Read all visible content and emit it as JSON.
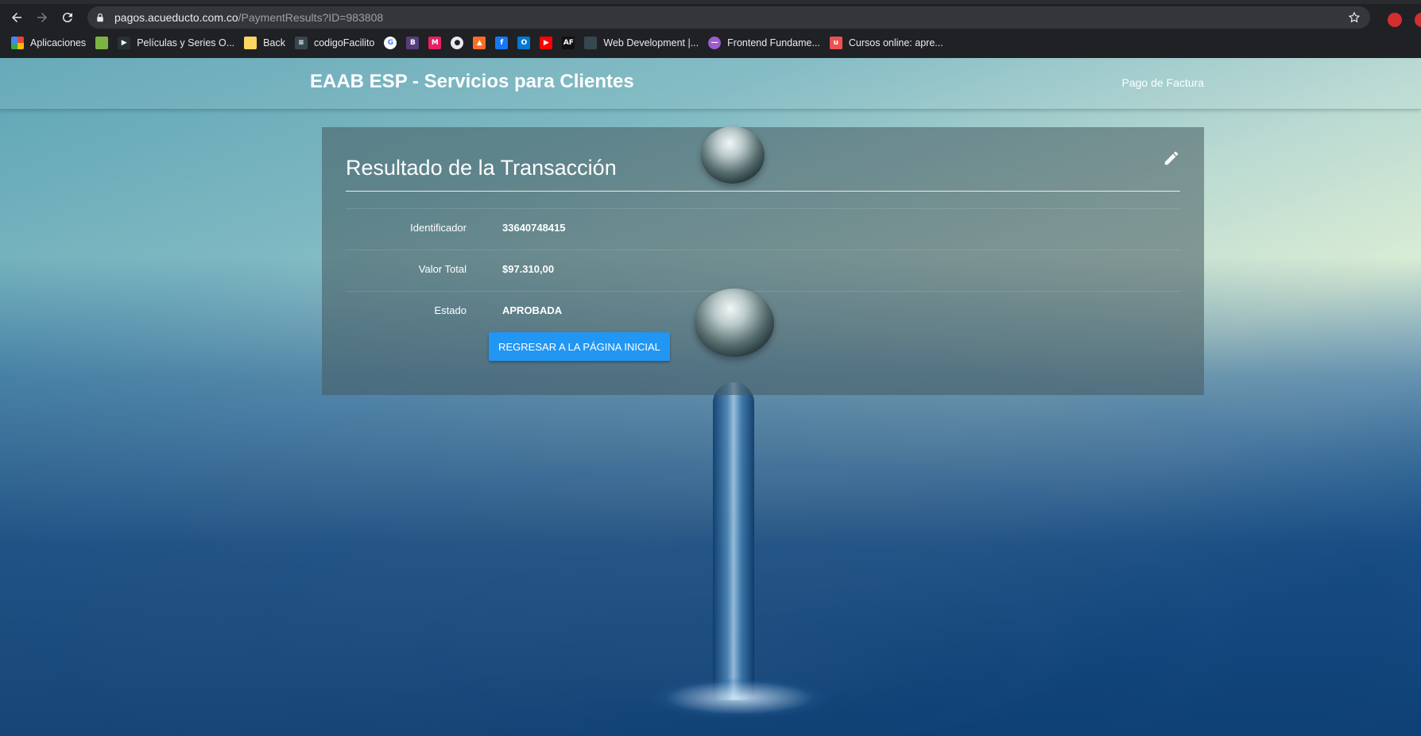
{
  "browser": {
    "url_domain": "pagos.acueducto.com.co",
    "url_path": "/PaymentResults?ID=983808",
    "bookmarks": [
      {
        "label": "Aplicaciones",
        "icon": "apps-grid-icon",
        "color": "#4285f4"
      },
      {
        "label": "",
        "icon": "android-icon",
        "color": "#7cb342"
      },
      {
        "label": "Películas y Series O...",
        "icon": "play-icon",
        "color": "#263238"
      },
      {
        "label": "Back",
        "icon": "folder-icon",
        "color": "#fdd663"
      },
      {
        "label": "codigoFacilito",
        "icon": "code-icon",
        "color": "#37474f"
      },
      {
        "label": "",
        "icon": "google-icon",
        "color": "#ffffff"
      },
      {
        "label": "",
        "icon": "bootstrap-icon",
        "color": "#563d7c"
      },
      {
        "label": "",
        "icon": "m-icon",
        "color": "#e91e63"
      },
      {
        "label": "",
        "icon": "github-icon",
        "color": "#e8eaed"
      },
      {
        "label": "",
        "icon": "gitlab-icon",
        "color": "#fc6d26"
      },
      {
        "label": "",
        "icon": "facebook-icon",
        "color": "#1877f2"
      },
      {
        "label": "",
        "icon": "outlook-icon",
        "color": "#0078d4"
      },
      {
        "label": "",
        "icon": "youtube-icon",
        "color": "#ff0000"
      },
      {
        "label": "",
        "icon": "af-icon",
        "color": "#111111"
      },
      {
        "label": "Web Development |...",
        "icon": "globe-icon",
        "color": "#37474f"
      },
      {
        "label": "Frontend Fundame...",
        "icon": "circle-icon",
        "color": "#9c5ccf"
      },
      {
        "label": "Cursos online: apre...",
        "icon": "udemy-icon",
        "color": "#ec5252"
      }
    ]
  },
  "header": {
    "brand": "EAAB ESP - Servicios para Clientes",
    "nav_link": "Pago de Factura"
  },
  "card": {
    "title": "Resultado de la Transacción",
    "rows": [
      {
        "label": "Identificador",
        "value": "33640748415"
      },
      {
        "label": "Valor Total",
        "value": "$97.310,00"
      },
      {
        "label": "Estado",
        "value": "APROBADA"
      }
    ],
    "button_label": "Regresar a la página inicial"
  }
}
